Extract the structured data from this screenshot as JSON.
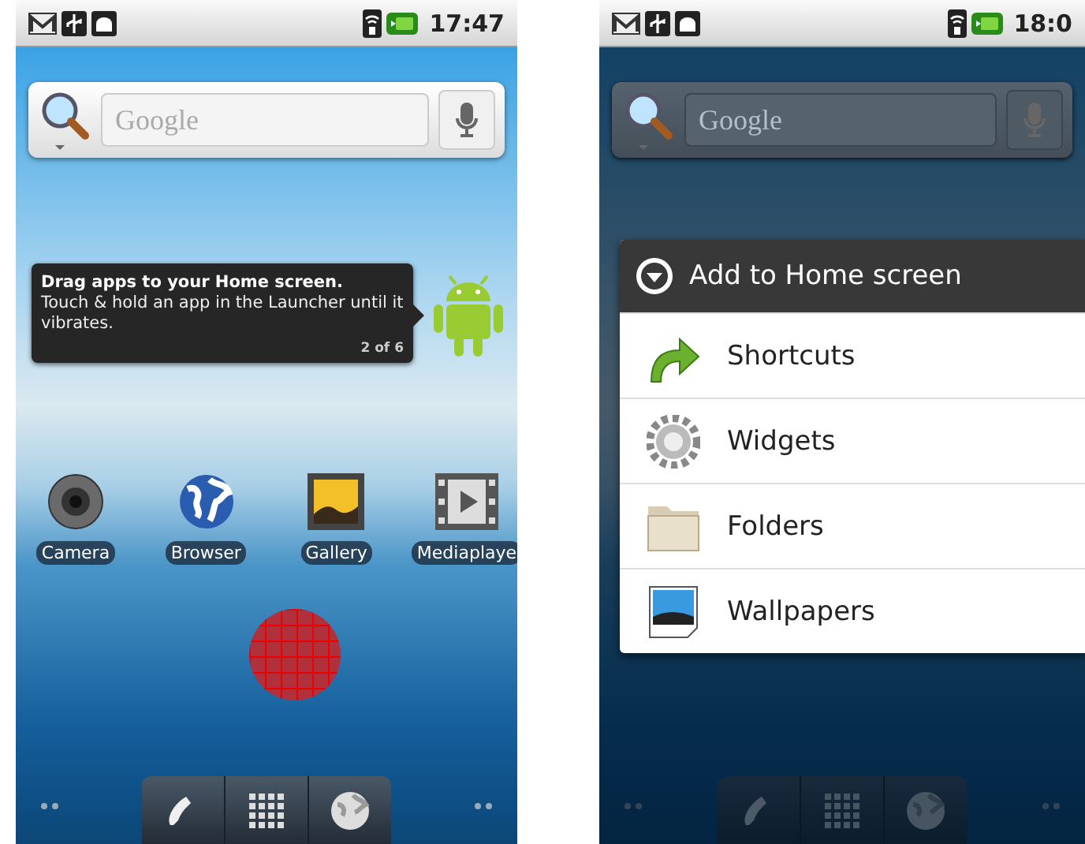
{
  "screens": [
    {
      "status_bar": {
        "time": "17:47"
      },
      "search": {
        "placeholder": "Google"
      },
      "dimmed": false,
      "tip": {
        "title": "Drag apps to your Home screen.",
        "body": "Touch & hold an app in the Launcher until it vibrates.",
        "counter": "2 of 6"
      },
      "apps": [
        {
          "label": "Camera",
          "kind": "camera"
        },
        {
          "label": "Browser",
          "kind": "browser"
        },
        {
          "label": "Gallery",
          "kind": "gallery"
        },
        {
          "label": "Mediaplaye",
          "kind": "media"
        }
      ]
    },
    {
      "status_bar": {
        "time": "18:0"
      },
      "search": {
        "placeholder": "Google"
      },
      "dimmed": true,
      "dialog": {
        "title": "Add to Home screen",
        "items": [
          {
            "label": "Shortcuts",
            "kind": "shortcut"
          },
          {
            "label": "Widgets",
            "kind": "widget"
          },
          {
            "label": "Folders",
            "kind": "folder"
          },
          {
            "label": "Wallpapers",
            "kind": "wallpaper"
          }
        ]
      }
    }
  ]
}
